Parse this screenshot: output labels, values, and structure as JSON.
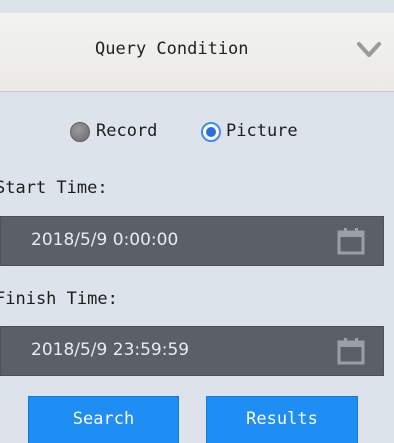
{
  "header": {
    "title": "Query Condition",
    "collapse_icon": "chevron-down-icon"
  },
  "mode": {
    "options": [
      {
        "label": "Record",
        "selected": false
      },
      {
        "label": "Picture",
        "selected": true
      }
    ]
  },
  "start": {
    "label": "Start Time:",
    "value": "2018/5/9 0:00:00",
    "icon": "calendar-icon"
  },
  "finish": {
    "label": "Finish Time:",
    "value": "2018/5/9 23:59:59",
    "icon": "calendar-icon"
  },
  "buttons": {
    "search": "Search",
    "results": "Results"
  },
  "colors": {
    "accent": "#1e8ef5",
    "panel_background": "#dde3ea",
    "field_background": "#5b6068",
    "radio_selected": "#2a6fe0"
  }
}
